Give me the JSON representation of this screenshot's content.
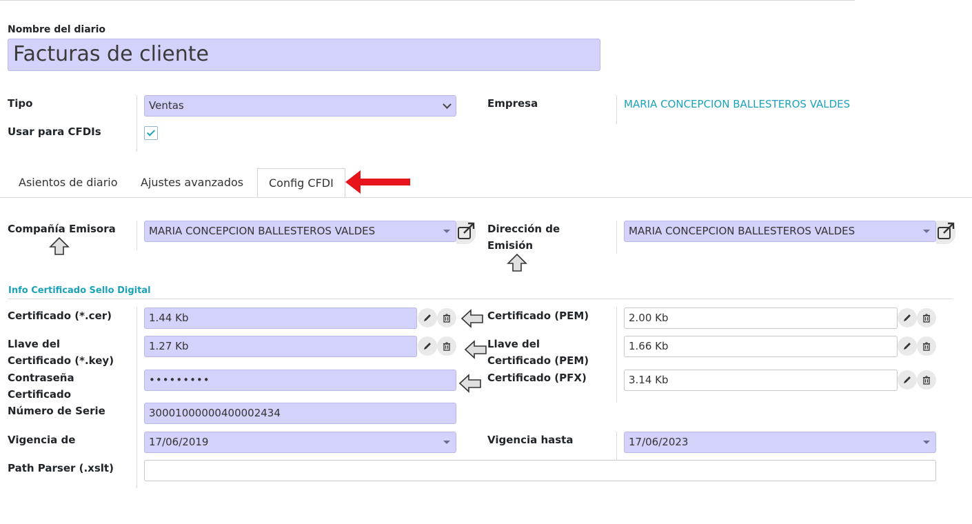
{
  "journal": {
    "name_label": "Nombre del diario",
    "name_value": "Facturas de cliente"
  },
  "general": {
    "tipo_label": "Tipo",
    "tipo_value": "Ventas",
    "cfdi_label": "Usar para CFDIs",
    "cfdi_checked": true,
    "empresa_label": "Empresa",
    "empresa_value": "MARIA CONCEPCION BALLESTEROS VALDES"
  },
  "tabs": [
    {
      "label": "Asientos de diario",
      "active": false
    },
    {
      "label": "Ajustes avanzados",
      "active": false
    },
    {
      "label": "Config CFDI",
      "active": true
    }
  ],
  "cfdi": {
    "compania_label": "Compañía Emisora",
    "compania_value": "MARIA CONCEPCION BALLESTEROS VALDES",
    "direccion_label_1": "Dirección de",
    "direccion_label_2": "Emisión",
    "direccion_value": "MARIA CONCEPCION BALLESTEROS VALDES",
    "section_title": "Info Certificado Sello Digital",
    "cer_label": "Certificado (*.cer)",
    "cer_value": "1.44 Kb",
    "key_label_1": "Llave del",
    "key_label_2": "Certificado (*.key)",
    "key_value": "1.27 Kb",
    "pass_label_1": "Contraseña",
    "pass_label_2": "Certificado",
    "pass_value": "•••••••••",
    "serie_label": "Número de Serie",
    "serie_value": "30001000000400002434",
    "vig_de_label": "Vigencia de",
    "vig_de_value": "17/06/2019",
    "path_label": "Path Parser (.xslt)",
    "path_value": "",
    "pem_label": "Certificado (PEM)",
    "pem_value": "2.00 Kb",
    "key_pem_label_1": "Llave del",
    "key_pem_label_2": "Certificado (PEM)",
    "key_pem_value": "1.66 Kb",
    "pfx_label": "Certificado (PFX)",
    "pfx_value": "3.14 Kb",
    "vig_hasta_label": "Vigencia hasta",
    "vig_hasta_value": "17/06/2023"
  },
  "colors": {
    "field_bg": "#d2d2fb",
    "link": "#1aa3b8",
    "annotation_arrow": "#e8141b"
  }
}
